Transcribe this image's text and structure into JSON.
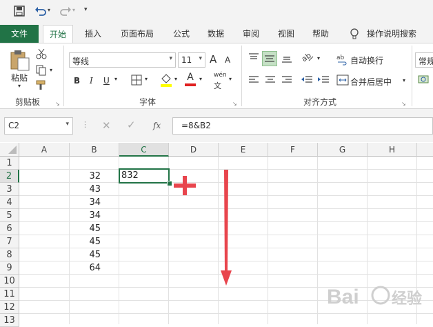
{
  "tabs": {
    "file": "文件",
    "home": "开始",
    "insert": "插入",
    "page_layout": "页面布局",
    "formulas": "公式",
    "data": "数据",
    "review": "审阅",
    "view": "视图",
    "help": "帮助",
    "tell_me": "操作说明搜索"
  },
  "clipboard": {
    "paste": "粘贴",
    "group": "剪贴板"
  },
  "font": {
    "name": "等线",
    "size": "11",
    "bold": "B",
    "italic": "I",
    "underline": "U",
    "group": "字体",
    "grow": "A",
    "shrink": "A",
    "color_a": "A",
    "phonetic": "wén"
  },
  "alignment": {
    "wrap": "自动换行",
    "merge": "合并后居中",
    "group": "对齐方式"
  },
  "number": {
    "format": "常规"
  },
  "formula_bar": {
    "name_box": "C2",
    "formula": "=8&B2",
    "fx": "fx"
  },
  "columns": [
    "A",
    "B",
    "C",
    "D",
    "E",
    "F",
    "G",
    "H"
  ],
  "rows": [
    "1",
    "2",
    "3",
    "4",
    "5",
    "6",
    "7",
    "8",
    "9",
    "10",
    "11",
    "12",
    "13"
  ],
  "cells": {
    "B": [
      "32",
      "43",
      "34",
      "34",
      "45",
      "45",
      "45",
      "64"
    ],
    "C2": "832"
  },
  "colors": {
    "accent": "#217346",
    "arrow": "#e8454d"
  }
}
